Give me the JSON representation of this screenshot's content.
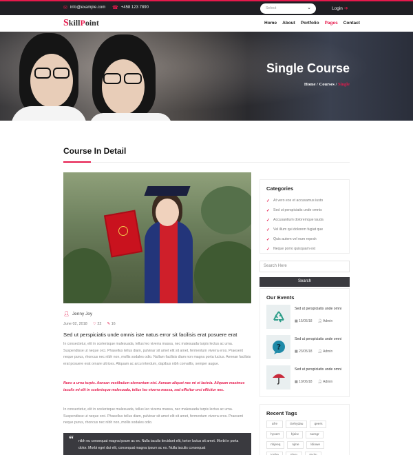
{
  "topbar": {
    "email": "info@example.com",
    "phone": "+458 123 7890",
    "select_placeholder": "Select",
    "login_label": "Login"
  },
  "nav": {
    "logo_s": "S",
    "logo_mid": "kill",
    "logo_p": "P",
    "logo_end": "oint",
    "items": [
      "Home",
      "About",
      "Portfolio",
      "Pages",
      "Contact"
    ],
    "active_item": "Pages"
  },
  "hero": {
    "title": "Single Course",
    "crumb_home": "Home",
    "crumb_courses": "Courses",
    "crumb_current": "Single"
  },
  "main": {
    "section_title": "Course In Detail",
    "author": "Jenny Joy",
    "date": "June 02, 2018",
    "likes": "22",
    "comments": "16",
    "post_title": "Sed ut perspiciatis unde omnis iste natus error sit facilisis erat posuere erat",
    "paragraph_1": "In consectetur, elit in scelerisque malesuada, tellus leo viverra massa, nec malesuada turpis lectus ac urna. Suspendisse ut neque orci. Phasellus tellus diam, pulvinar sit amet elit sit amet, fermentum viverra eros. Praesent neque purus, rhoncus nec nibh non, mollis sodales odio. Nullam facilisis diam non magna porta luctus. Aenean facilisis erat posuere erat ornare ultrices. Aliquam ac arcu interdum, dapibus nibh convallis, semper augue.",
    "paragraph_2": "Nunc a urna turpis. Aenean vestibulum elementum nisi. Aenean aliquet nec mi et lacinia. Aliquam maximus iaculis mi elit in scelerisque malesuada, tellus leo viverra massa, sed efficitur orci efficitur nec.",
    "paragraph_3": "In consectetur, elit in scelerisque malesuada, tellus leo viverra massa, nec malesuada turpis lectus ac urna. Suspendisse ut neque orci. Phasellus tellus diam, pulvinar sit amet elit sit amet, fermentum viverra eros. Praesent neque purus, rhoncus nec nibh non, mollis sodales odio.",
    "quote": "nibh eu consequat magna ipsum ac ex. Nulla iaculis tincidunt elit, tortor luctus sit amet. Morbi in porta dolor. Morbi eget dui elit, consequat magna ipsum ac ex. Nulla iaculis consequat"
  },
  "sidebar": {
    "categories_title": "Categories",
    "categories": [
      "At vero eos et accusamus iusto",
      "Sed ut perspiciatis unde omnis",
      "Accusantium doloremque lauda",
      "Vel illum qui dolorem fugiat que",
      "Quis autem vel eum reprah",
      "Neque porro quisquam est"
    ],
    "search_placeholder": "Search Here",
    "search_button": "Search",
    "events_title": "Our Events",
    "events": [
      {
        "title": "Sed ut perspiciatis unde omni",
        "date": "15/05/18",
        "author": "Admin",
        "icon": "recycle-icon"
      },
      {
        "title": "Sed ut perspiciatis unde omni",
        "date": "23/05/18",
        "author": "Admin",
        "icon": "question-bubble-icon"
      },
      {
        "title": "Sed ut perspiciatis unde omni",
        "date": "10/06/18",
        "author": "Admin",
        "icon": "umbrella-icon"
      }
    ],
    "tags_title": "Recent Tags",
    "tags": [
      "afre",
      "Gehydau",
      "qeers",
      "hyoert",
      "hjeiw",
      "sumgr",
      "nhjeeq",
      "njme",
      "ldiowe",
      "ioghe",
      "nhyu",
      "mxiju"
    ]
  },
  "colors": {
    "accent": "#e6194c",
    "dark": "#1f1f24",
    "panel": "#3a3a3f"
  }
}
